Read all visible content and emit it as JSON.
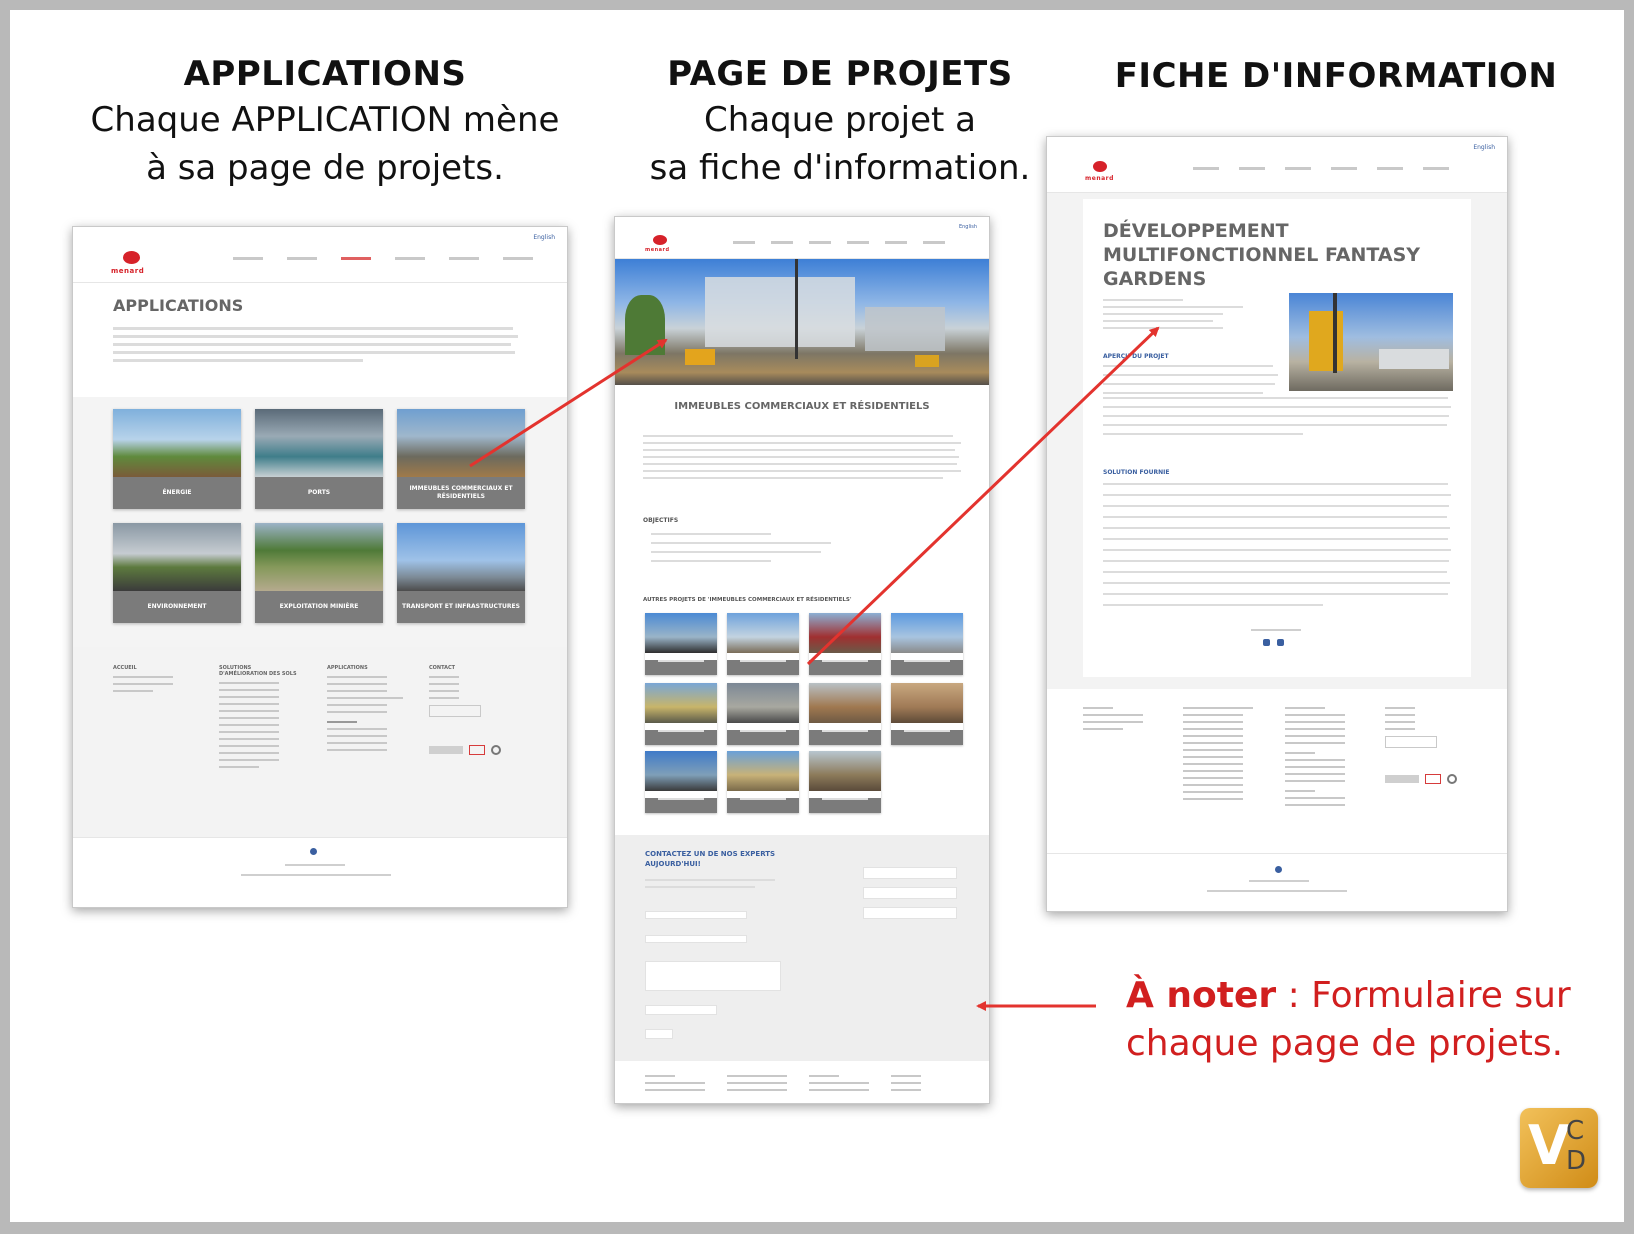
{
  "columns": [
    {
      "heading": "APPLICATIONS",
      "line1": "Chaque APPLICATION mène",
      "line2": "à sa page de projets."
    },
    {
      "heading": "PAGE DE PROJETS",
      "line1": "Chaque projet a",
      "line2": "sa fiche d'information."
    },
    {
      "heading": "FICHE D'INFORMATION"
    }
  ],
  "page1": {
    "title": "APPLICATIONS",
    "lang": "English",
    "logo": "menard",
    "tiles": [
      {
        "label": "ÉNERGIE"
      },
      {
        "label": "PORTS"
      },
      {
        "label": "IMMEUBLES COMMERCIAUX ET RÉSIDENTIELS"
      },
      {
        "label": "ENVIRONNEMENT"
      },
      {
        "label": "EXPLOITATION MINIÈRE"
      },
      {
        "label": "TRANSPORT ET INFRASTRUCTURES"
      }
    ],
    "footer_headings": [
      "ACCUEIL",
      "SOLUTIONS D'AMÉLIORATION DES SOLS",
      "APPLICATIONS",
      "CONTACT"
    ]
  },
  "page2": {
    "lang": "English",
    "logo": "menard",
    "section_title": "IMMEUBLES COMMERCIAUX ET RÉSIDENTIELS",
    "objectives_title": "OBJECTIFS",
    "other_projects_title": "AUTRES PROJETS DE 'IMMEUBLES COMMERCIAUX ET RÉSIDENTIELS'",
    "contact_title_1": "CONTACTEZ UN DE NOS EXPERTS",
    "contact_title_2": "AUJOURD'HUI!"
  },
  "page3": {
    "lang": "English",
    "logo": "menard",
    "title_1": "DÉVELOPPEMENT",
    "title_2": "MULTIFONCTIONNEL FANTASY",
    "title_3": "GARDENS",
    "overview_title": "APERÇU DU PROJET",
    "solution_title": "SOLUTION FOURNIE"
  },
  "note": {
    "bold": "À noter",
    "rest": " : Formulaire sur",
    "line2": "chaque page de projets."
  },
  "badge": {
    "v": "V",
    "c": "C",
    "d": "D"
  },
  "colors": {
    "accent_red": "#d6222a",
    "arrow_red": "#e3332e",
    "link_blue": "#3a5fa0",
    "tile_caption": "#7b7b7b"
  }
}
